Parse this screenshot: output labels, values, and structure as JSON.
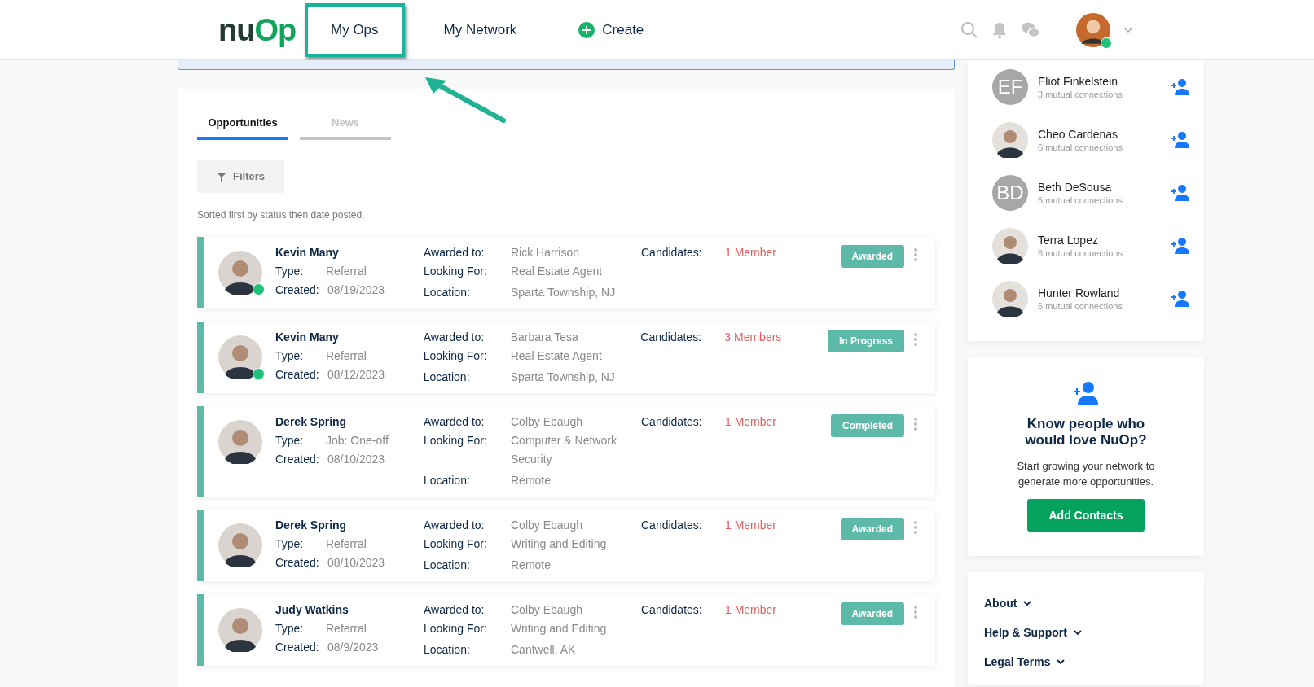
{
  "header": {
    "logo_parts": [
      "nu",
      "Op"
    ],
    "nav": [
      {
        "label": "My Ops",
        "selected": true,
        "kind": "link"
      },
      {
        "label": "My Network",
        "selected": false,
        "kind": "link"
      },
      {
        "label": "Create",
        "selected": false,
        "kind": "create"
      }
    ],
    "user": {
      "verified": true
    }
  },
  "tabs": [
    {
      "label": "Opportunities",
      "selected": true
    },
    {
      "label": "News",
      "selected": false
    }
  ],
  "filters_button": "Filters",
  "sort_note": "Sorted first by status then date posted.",
  "opportunities": [
    {
      "name": "Kevin Many",
      "verified": true,
      "labels": {
        "type": "Type:",
        "created": "Created:",
        "awarded": "Awarded to:",
        "looking": "Looking For:",
        "location": "Location:",
        "candidates": "Candidates:"
      },
      "type": "Referral",
      "created": "08/19/2023",
      "awarded_to": "Rick Harrison",
      "looking_for": "Real Estate Agent",
      "location": "Sparta Township, NJ",
      "candidates": "1 Member",
      "status": "Awarded"
    },
    {
      "name": "Kevin Many",
      "verified": true,
      "labels": {
        "type": "Type:",
        "created": "Created:",
        "awarded": "Awarded to:",
        "looking": "Looking For:",
        "location": "Location:",
        "candidates": "Candidates:"
      },
      "type": "Referral",
      "created": "08/12/2023",
      "awarded_to": "Barbara Tesa",
      "looking_for": "Real Estate Agent",
      "location": "Sparta Township, NJ",
      "candidates": "3 Members",
      "status": "In Progress"
    },
    {
      "name": "Derek Spring",
      "verified": false,
      "labels": {
        "type": "Type:",
        "created": "Created:",
        "awarded": "Awarded to:",
        "looking": "Looking For:",
        "location": "Location:",
        "candidates": "Candidates:"
      },
      "type": "Job: One-off",
      "created": "08/10/2023",
      "awarded_to": "Colby Ebaugh",
      "looking_for": "Computer & Network Security",
      "location": "Remote",
      "candidates": "1 Member",
      "status": "Completed"
    },
    {
      "name": "Derek Spring",
      "verified": false,
      "labels": {
        "type": "Type:",
        "created": "Created:",
        "awarded": "Awarded to:",
        "looking": "Looking For:",
        "location": "Location:",
        "candidates": "Candidates:"
      },
      "type": "Referral",
      "created": "08/10/2023",
      "awarded_to": "Colby Ebaugh",
      "looking_for": "Writing and Editing",
      "location": "Remote",
      "candidates": "1 Member",
      "status": "Awarded"
    },
    {
      "name": "Judy Watkins",
      "verified": false,
      "labels": {
        "type": "Type:",
        "created": "Created:",
        "awarded": "Awarded to:",
        "looking": "Looking For:",
        "location": "Location:",
        "candidates": "Candidates:"
      },
      "type": "Referral",
      "created": "08/9/2023",
      "awarded_to": "Colby Ebaugh",
      "looking_for": "Writing and Editing",
      "location": "Cantwell, AK",
      "candidates": "1 Member",
      "status": "Awarded"
    }
  ],
  "suggestions": [
    {
      "kind": "initials",
      "initials": "EF",
      "name": "Eliot Finkelstein",
      "mutual": "3 mutual connections"
    },
    {
      "kind": "photo",
      "name": "Cheo Cardenas",
      "mutual": "6 mutual connections"
    },
    {
      "kind": "initials",
      "initials": "BD",
      "name": "Beth DeSousa",
      "mutual": "5 mutual connections"
    },
    {
      "kind": "photo",
      "name": "Terra Lopez",
      "mutual": "6 mutual connections"
    },
    {
      "kind": "photo",
      "name": "Hunter Rowland",
      "mutual": "6 mutual connections"
    }
  ],
  "invite": {
    "title": "Know people who would love NuOp?",
    "text": "Start growing your network to generate more opportunities.",
    "button": "Add Contacts"
  },
  "footer_links": [
    "About",
    "Help & Support",
    "Legal Terms"
  ]
}
